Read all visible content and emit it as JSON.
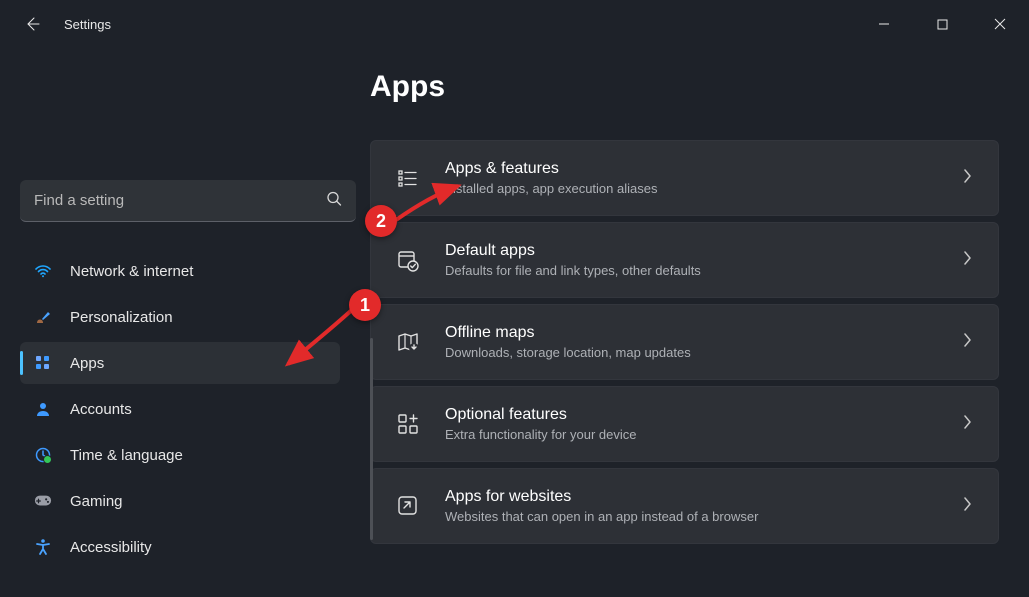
{
  "window": {
    "title": "Settings"
  },
  "header": {
    "page_title": "Apps"
  },
  "search": {
    "placeholder": "Find a setting"
  },
  "sidebar": {
    "items": [
      {
        "label": "Network & internet",
        "icon": "wifi",
        "selected": false
      },
      {
        "label": "Personalization",
        "icon": "brush",
        "selected": false
      },
      {
        "label": "Apps",
        "icon": "apps",
        "selected": true
      },
      {
        "label": "Accounts",
        "icon": "person",
        "selected": false
      },
      {
        "label": "Time & language",
        "icon": "clock",
        "selected": false
      },
      {
        "label": "Gaming",
        "icon": "gamepad",
        "selected": false
      },
      {
        "label": "Accessibility",
        "icon": "access",
        "selected": false
      }
    ]
  },
  "cards": [
    {
      "title": "Apps & features",
      "sub": "Installed apps, app execution aliases",
      "icon": "list"
    },
    {
      "title": "Default apps",
      "sub": "Defaults for file and link types, other defaults",
      "icon": "default"
    },
    {
      "title": "Offline maps",
      "sub": "Downloads, storage location, map updates",
      "icon": "map"
    },
    {
      "title": "Optional features",
      "sub": "Extra functionality for your device",
      "icon": "addon"
    },
    {
      "title": "Apps for websites",
      "sub": "Websites that can open in an app instead of a browser",
      "icon": "openweb"
    }
  ],
  "annotations": {
    "marker1": "1",
    "marker2": "2"
  }
}
